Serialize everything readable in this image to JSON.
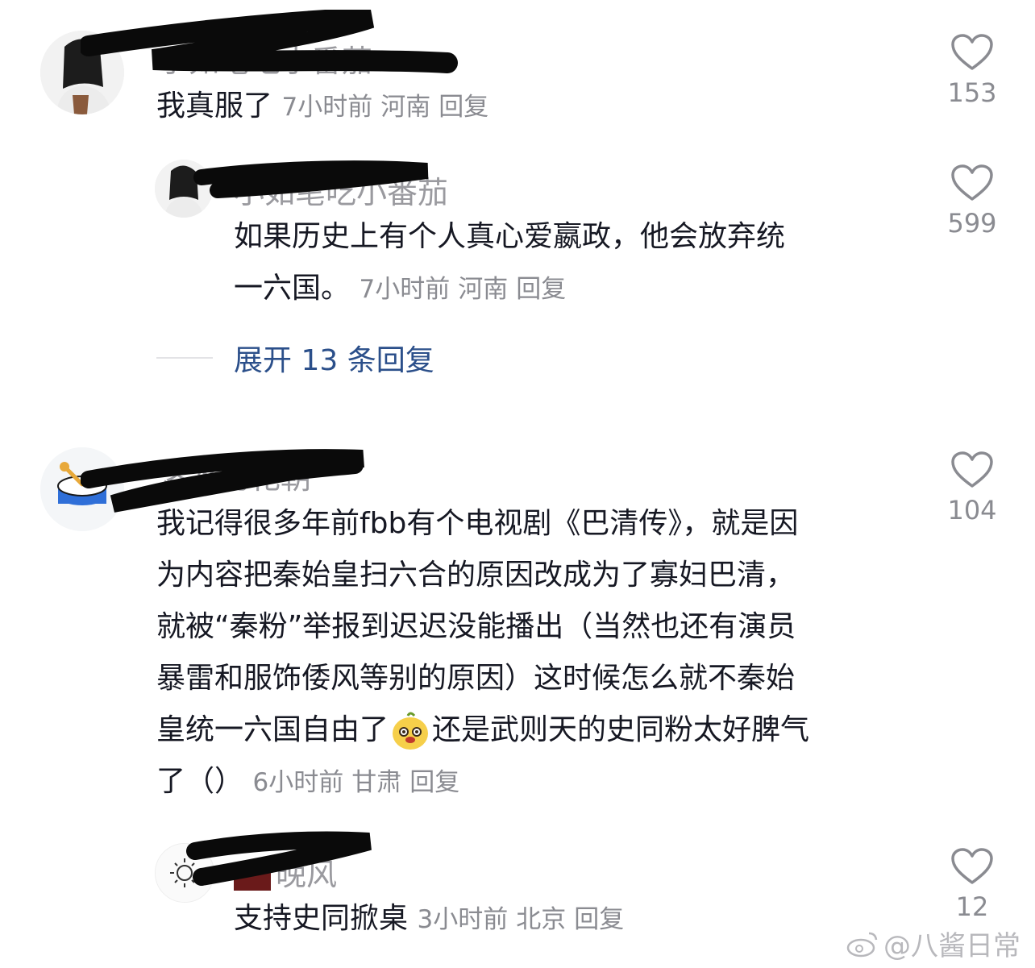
{
  "comments": [
    {
      "username": "小如笔吃小番茄",
      "text": "我真服了",
      "time": "7小时前",
      "location": "河南",
      "reply_label": "回复",
      "likes": "153"
    },
    {
      "username": "小如笔吃小番茄",
      "text": "如果历史上有个人真心爱嬴政，他会放弃统一六国。",
      "line1": "如果历史上有个人真心爱嬴政，他会放弃统",
      "line2": "一六国。",
      "time": "7小时前",
      "location": "河南",
      "reply_label": "回复",
      "likes": "599"
    },
    {
      "username": "洛水的花朝",
      "lines": [
        "我记得很多年前fbb有个电视剧《巴清传》，就是因",
        "为内容把秦始皇扫六合的原因改成为了寡妇巴清，",
        "就被“秦粉”举报到迟迟没能播出（当然也还有演员",
        "暴雷和服饰倭风等别的原因）这时候怎么就不秦始",
        "皇统一六国自由了",
        "还是武则天的史同粉太好脾气",
        "了（）"
      ],
      "time": "6小时前",
      "location": "甘肃",
      "reply_label": "回复",
      "likes": "104"
    },
    {
      "username": "晚风",
      "text": "支持史同掀桌",
      "time": "3小时前",
      "location": "北京",
      "reply_label": "回复",
      "likes": "12"
    }
  ],
  "expand_replies": "展开 13 条回复",
  "watermark": "@八酱日常",
  "icons": {
    "like": "heart-outline-icon",
    "emoji": "fox-face-emoji-icon",
    "weibo": "weibo-logo-icon"
  },
  "colors": {
    "text": "#161823",
    "meta": "#8a8b91",
    "link": "#2b4f8a",
    "heart": "#8a8b91"
  }
}
